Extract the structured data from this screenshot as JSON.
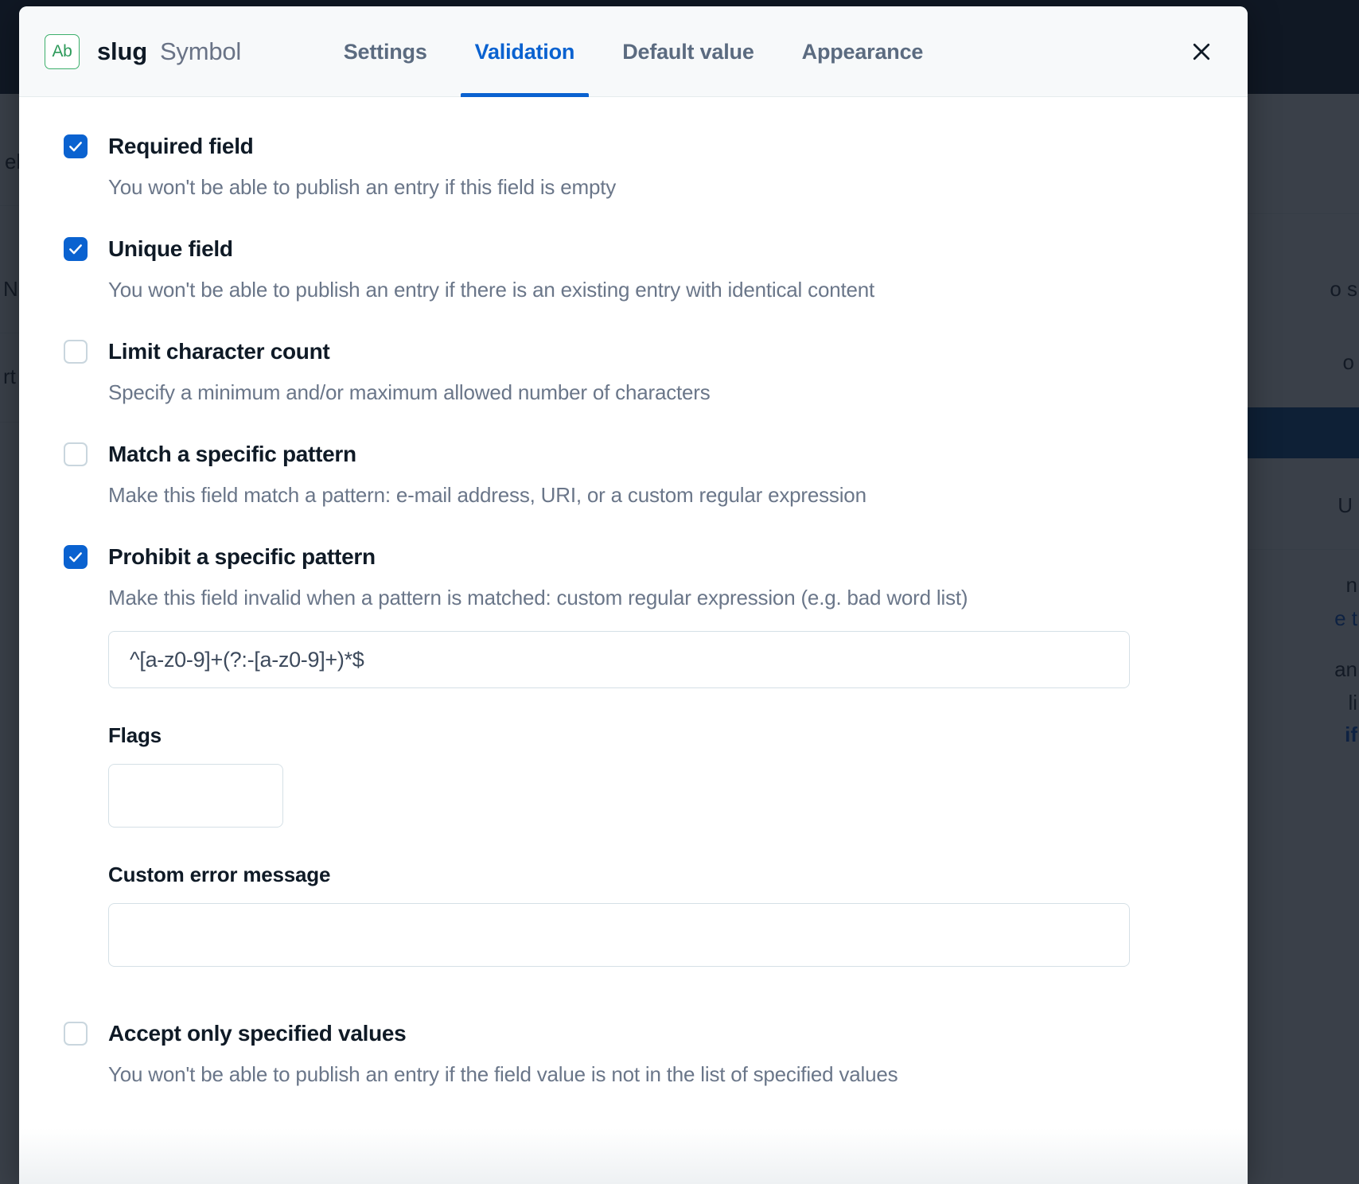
{
  "modal": {
    "field_badge": "Ab",
    "field_name": "slug",
    "field_type": "Symbol",
    "close_icon": "close-icon",
    "accent_color": "#0a62d0",
    "badge_border_color": "#3caf6b",
    "tabs": [
      {
        "label": "Settings",
        "active": false
      },
      {
        "label": "Validation",
        "active": true
      },
      {
        "label": "Default value",
        "active": false
      },
      {
        "label": "Appearance",
        "active": false
      }
    ],
    "options": [
      {
        "id": "required-field",
        "label": "Required field",
        "description": "You won't be able to publish an entry if this field is empty",
        "checked": true
      },
      {
        "id": "unique-field",
        "label": "Unique field",
        "description": "You won't be able to publish an entry if there is an existing entry with identical content",
        "checked": true
      },
      {
        "id": "limit-character-count",
        "label": "Limit character count",
        "description": "Specify a minimum and/or maximum allowed number of characters",
        "checked": false
      },
      {
        "id": "match-a-specific-pattern",
        "label": "Match a specific pattern",
        "description": "Make this field match a pattern: e-mail address, URI, or a custom regular expression",
        "checked": false
      },
      {
        "id": "prohibit-a-specific-pattern",
        "label": "Prohibit a specific pattern",
        "description": "Make this field invalid when a pattern is matched: custom regular expression (e.g. bad word list)",
        "checked": true
      },
      {
        "id": "accept-only-specified-values",
        "label": "Accept only specified values",
        "description": "You won't be able to publish an entry if the field value is not in the list of specified values",
        "checked": false
      }
    ],
    "prohibit_pattern": {
      "regex_value": "^[a-z0-9]+(?:-[a-z0-9]+)*$",
      "regex_placeholder": "",
      "flags_label": "Flags",
      "flags_value": "",
      "flags_placeholder": "",
      "custom_error_label": "Custom error message",
      "custom_error_value": "",
      "custom_error_placeholder": ""
    }
  },
  "backdrop": {
    "rows": [
      {
        "text": "el"
      },
      {
        "text": "N"
      },
      {
        "text": "rt"
      }
    ],
    "right_rows": [
      {
        "text": "o s"
      },
      {
        "text": "o"
      },
      {
        "text": "U"
      },
      {
        "text": "n"
      },
      {
        "text": "e t"
      },
      {
        "text": "an"
      },
      {
        "text": "li"
      },
      {
        "text": "if"
      }
    ]
  }
}
